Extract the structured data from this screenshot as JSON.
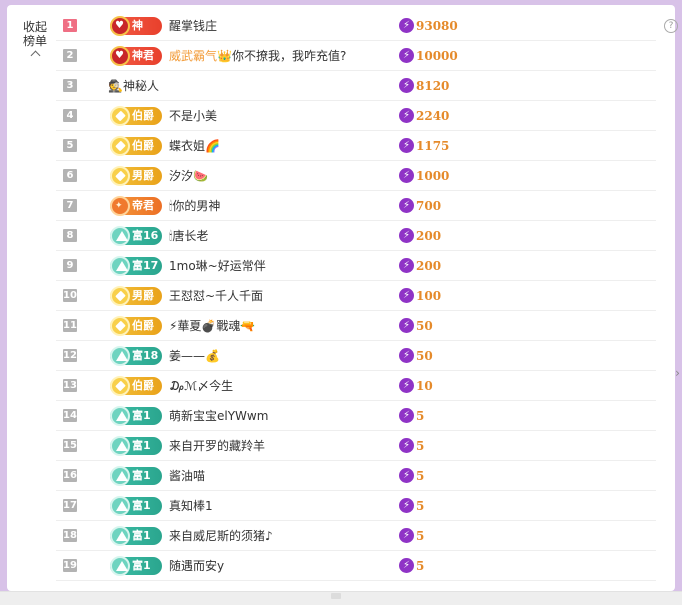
{
  "sidebar": {
    "collapse_label": "收起榜单",
    "collapse_icon": "chevron-up-icon"
  },
  "help_icon": "question-circle-icon",
  "currency_icon": "lightning-coin-icon",
  "colors": {
    "score": "#e58a2a",
    "rank_top": "#ef6f84",
    "rank_default": "#b3b3b3",
    "coin": "#8f33c6",
    "panel_bg": "#d8c2e8"
  },
  "ranking": [
    {
      "rank": "1",
      "badge": "神",
      "badge_style": "red",
      "name": "醒掌钱庄",
      "score": "93080"
    },
    {
      "rank": "2",
      "badge": "神君",
      "badge_style": "red",
      "name_highlight": "威武霸气",
      "name": "👑你不撩我，我咋充值?",
      "score": "10000"
    },
    {
      "rank": "3",
      "badge": "",
      "badge_style": "none",
      "name": "🕵神秘人",
      "score": "8120"
    },
    {
      "rank": "4",
      "badge": "伯爵",
      "badge_style": "gold",
      "name": "不是小美",
      "score": "2240"
    },
    {
      "rank": "5",
      "badge": "伯爵",
      "badge_style": "gold",
      "name": "蝶衣姐🌈",
      "score": "1175"
    },
    {
      "rank": "6",
      "badge": "男爵",
      "badge_style": "gold",
      "name": "汐汐🍉",
      "score": "1000"
    },
    {
      "rank": "7",
      "badge": "帝君",
      "badge_style": "orange",
      "name": "🕯你的男神",
      "score": "700"
    },
    {
      "rank": "8",
      "badge": "富16",
      "badge_style": "teal",
      "name": "🕯唐长老",
      "score": "200"
    },
    {
      "rank": "9",
      "badge": "富17",
      "badge_style": "teal",
      "name": "1mo琳~好运常伴",
      "score": "200"
    },
    {
      "rank": "10",
      "badge": "男爵",
      "badge_style": "gold",
      "name": "王怼怼~千人千面",
      "score": "100"
    },
    {
      "rank": "11",
      "badge": "伯爵",
      "badge_style": "gold",
      "name": "⚡華夏💣戰魂🔫",
      "score": "50"
    },
    {
      "rank": "12",
      "badge": "富18",
      "badge_style": "teal",
      "name": "姜——💰",
      "score": "50"
    },
    {
      "rank": "13",
      "badge": "伯爵",
      "badge_style": "gold",
      "name": "₯ℳ〆今生",
      "score": "10"
    },
    {
      "rank": "14",
      "badge": "富1",
      "badge_style": "teal",
      "name": "萌新宝宝elYWwm",
      "score": "5"
    },
    {
      "rank": "15",
      "badge": "富1",
      "badge_style": "teal",
      "name": "来自开罗的藏羚羊",
      "score": "5"
    },
    {
      "rank": "16",
      "badge": "富1",
      "badge_style": "teal",
      "name": "酱油喵",
      "score": "5"
    },
    {
      "rank": "17",
      "badge": "富1",
      "badge_style": "teal",
      "name": "真知棒1",
      "score": "5"
    },
    {
      "rank": "18",
      "badge": "富1",
      "badge_style": "teal",
      "name": "来自威尼斯的须猪♪",
      "score": "5"
    },
    {
      "rank": "19",
      "badge": "富1",
      "badge_style": "teal",
      "name": "随遇而安y",
      "score": "5"
    }
  ]
}
